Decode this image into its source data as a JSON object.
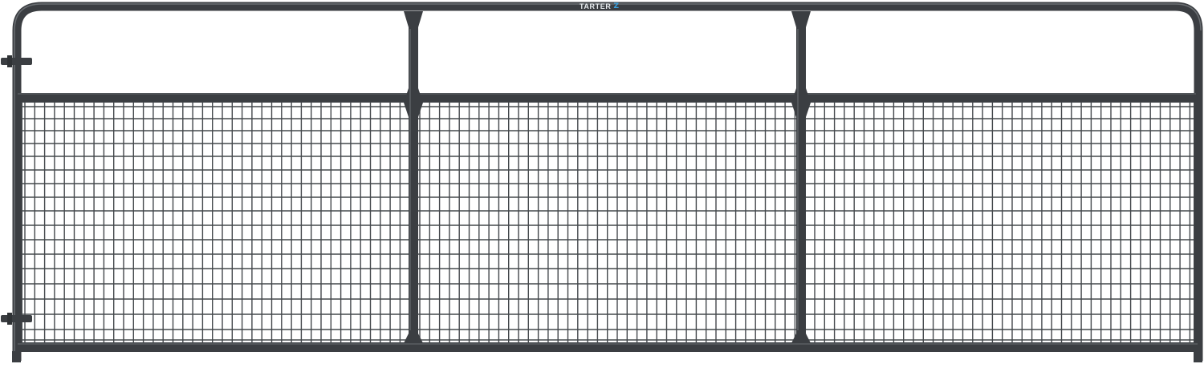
{
  "product": {
    "brand_text": "TARTER",
    "brand_mark": "Z",
    "frame_color": "#3b3e42",
    "frame_highlight": "#5c6064",
    "wire_color": "#44484c",
    "brand_mark_color": "#3aa0dc",
    "logo_icon": "tarter-logo-icon"
  }
}
